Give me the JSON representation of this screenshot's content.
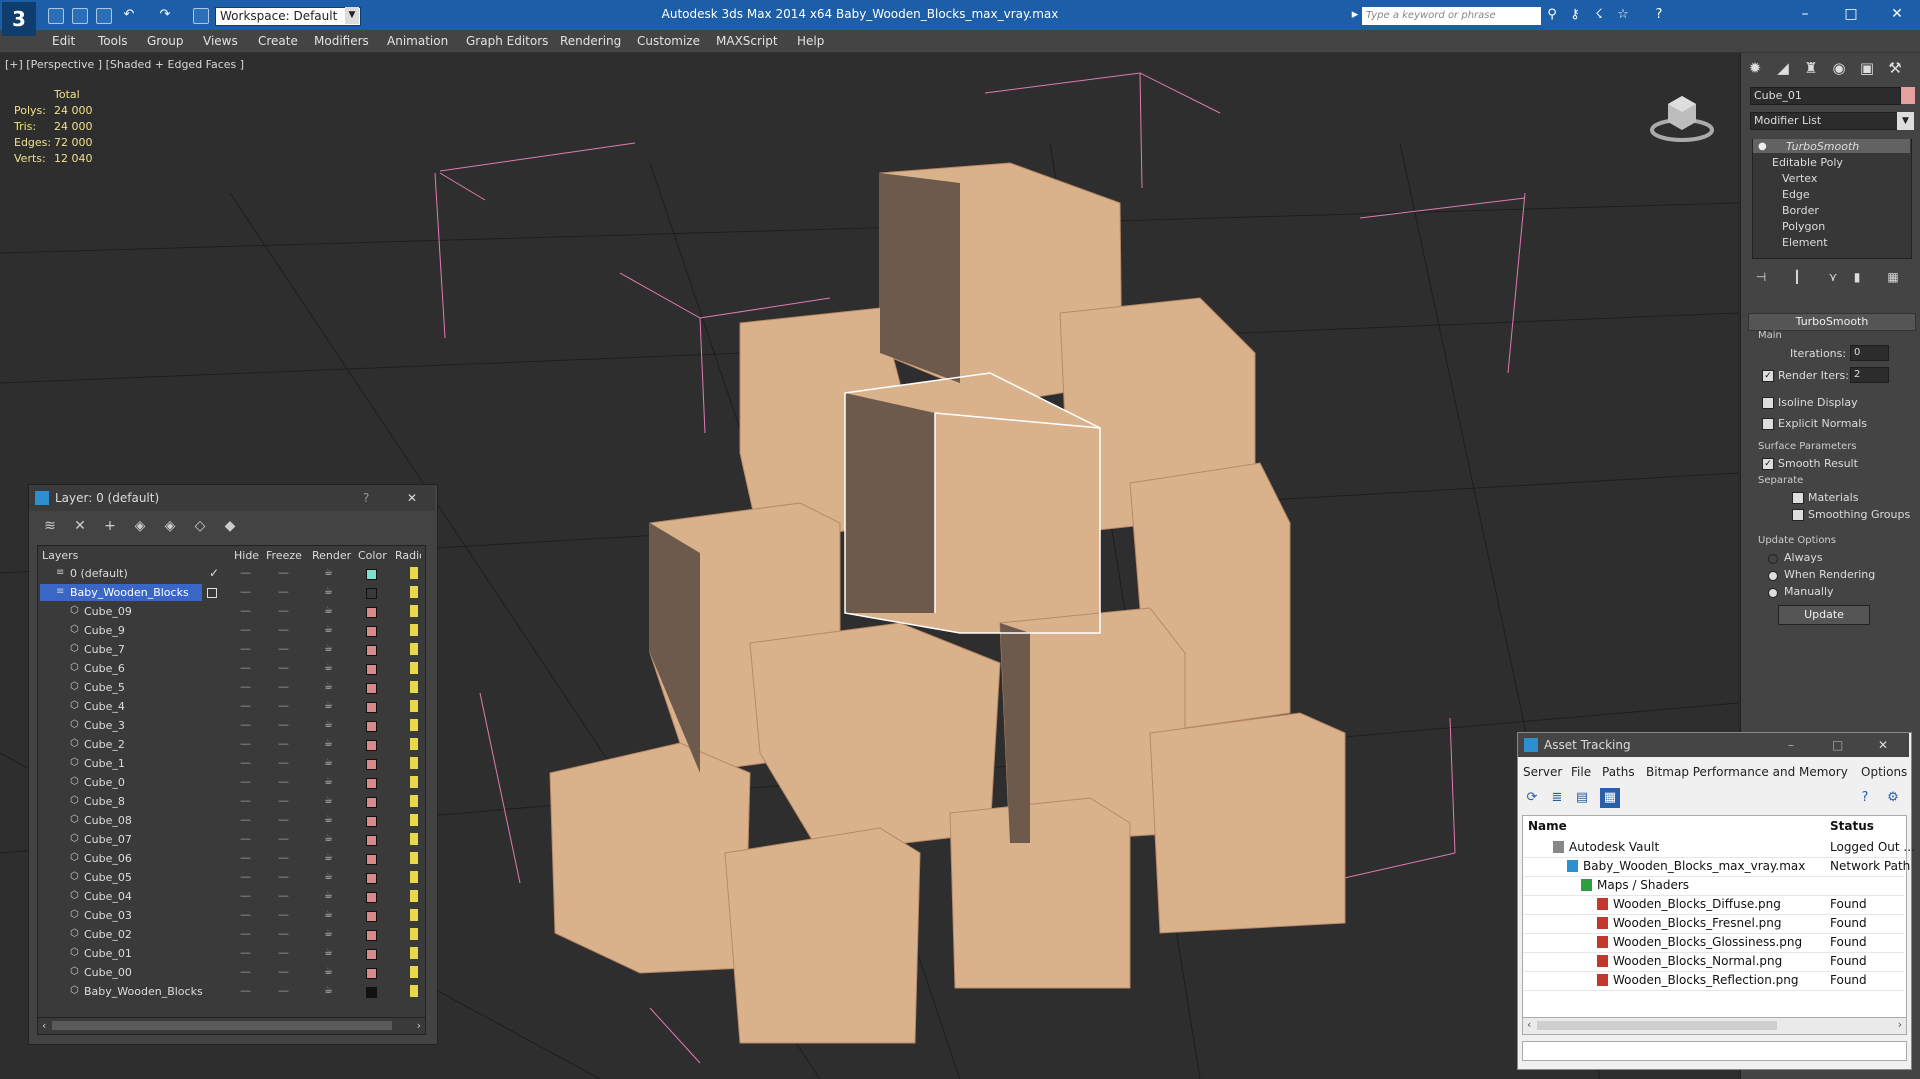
{
  "titlebar": {
    "workspace": "Workspace: Default",
    "title": "Autodesk 3ds Max  2014 x64      Baby_Wooden_Blocks_max_vray.max",
    "search_placeholder": "Type a keyword or phrase"
  },
  "menu": [
    "Edit",
    "Tools",
    "Group",
    "Views",
    "Create",
    "Modifiers",
    "Animation",
    "Graph Editors",
    "Rendering",
    "Customize",
    "MAXScript",
    "Help"
  ],
  "viewport": {
    "label": "[+] [Perspective ] [Shaded + Edged Faces ]",
    "stats_header": "Total",
    "stats": [
      {
        "label": "Polys:",
        "value": "24 000"
      },
      {
        "label": "Tris:",
        "value": "24 000"
      },
      {
        "label": "Edges:",
        "value": "72 000"
      },
      {
        "label": "Verts:",
        "value": "12 040"
      }
    ]
  },
  "command_panel": {
    "object_name": "Cube_01",
    "object_color": "#e7a0a0",
    "modifier_list": "Modifier List",
    "stack": [
      "TurboSmooth",
      "Editable Poly",
      "Vertex",
      "Edge",
      "Border",
      "Polygon",
      "Element"
    ],
    "rollout_title": "TurboSmooth",
    "main_label": "Main",
    "iterations_label": "Iterations:",
    "iterations_value": "0",
    "render_iters_label": "Render Iters:",
    "render_iters_value": "2",
    "isoline_label": "Isoline Display",
    "explicit_label": "Explicit Normals",
    "surface_label": "Surface Parameters",
    "smooth_result_label": "Smooth Result",
    "separate_label": "Separate",
    "materials_label": "Materials",
    "smoothing_groups_label": "Smoothing Groups",
    "update_options_label": "Update Options",
    "always_label": "Always",
    "when_rendering_label": "When Rendering",
    "manually_label": "Manually",
    "update_button": "Update"
  },
  "layer_window": {
    "title": "Layer: 0 (default)",
    "help": "?",
    "columns": [
      "Layers",
      "Hide",
      "Freeze",
      "Render",
      "Color",
      "Radio"
    ],
    "rows": [
      {
        "name": "0 (default)",
        "color": "#7fe0d0"
      },
      {
        "name": "Baby_Wooden_Blocks",
        "color": "#3a3a3a"
      },
      {
        "name": "Cube_09",
        "color": "#d88a8a"
      },
      {
        "name": "Cube_9",
        "color": "#d88a8a"
      },
      {
        "name": "Cube_7",
        "color": "#d88a8a"
      },
      {
        "name": "Cube_6",
        "color": "#d88a8a"
      },
      {
        "name": "Cube_5",
        "color": "#d88a8a"
      },
      {
        "name": "Cube_4",
        "color": "#d88a8a"
      },
      {
        "name": "Cube_3",
        "color": "#d88a8a"
      },
      {
        "name": "Cube_2",
        "color": "#d88a8a"
      },
      {
        "name": "Cube_1",
        "color": "#d88a8a"
      },
      {
        "name": "Cube_0",
        "color": "#d88a8a"
      },
      {
        "name": "Cube_8",
        "color": "#d88a8a"
      },
      {
        "name": "Cube_08",
        "color": "#d88a8a"
      },
      {
        "name": "Cube_07",
        "color": "#d88a8a"
      },
      {
        "name": "Cube_06",
        "color": "#d88a8a"
      },
      {
        "name": "Cube_05",
        "color": "#d88a8a"
      },
      {
        "name": "Cube_04",
        "color": "#d88a8a"
      },
      {
        "name": "Cube_03",
        "color": "#d88a8a"
      },
      {
        "name": "Cube_02",
        "color": "#d88a8a"
      },
      {
        "name": "Cube_01",
        "color": "#d88a8a"
      },
      {
        "name": "Cube_00",
        "color": "#d88a8a"
      },
      {
        "name": "Baby_Wooden_Blocks",
        "color": "#111111"
      }
    ]
  },
  "asset_window": {
    "title": "Asset Tracking",
    "menu": [
      "Server",
      "File",
      "Paths",
      "Bitmap Performance and Memory",
      "Options"
    ],
    "columns": [
      "Name",
      "Status"
    ],
    "rows": [
      {
        "name": "Autodesk Vault",
        "status": "Logged Out ..."
      },
      {
        "name": "Baby_Wooden_Blocks_max_vray.max",
        "status": "Network Path"
      },
      {
        "name": "Maps / Shaders",
        "status": ""
      },
      {
        "name": "Wooden_Blocks_Diffuse.png",
        "status": "Found"
      },
      {
        "name": "Wooden_Blocks_Fresnel.png",
        "status": "Found"
      },
      {
        "name": "Wooden_Blocks_Glossiness.png",
        "status": "Found"
      },
      {
        "name": "Wooden_Blocks_Normal.png",
        "status": "Found"
      },
      {
        "name": "Wooden_Blocks_Reflection.png",
        "status": "Found"
      }
    ]
  }
}
